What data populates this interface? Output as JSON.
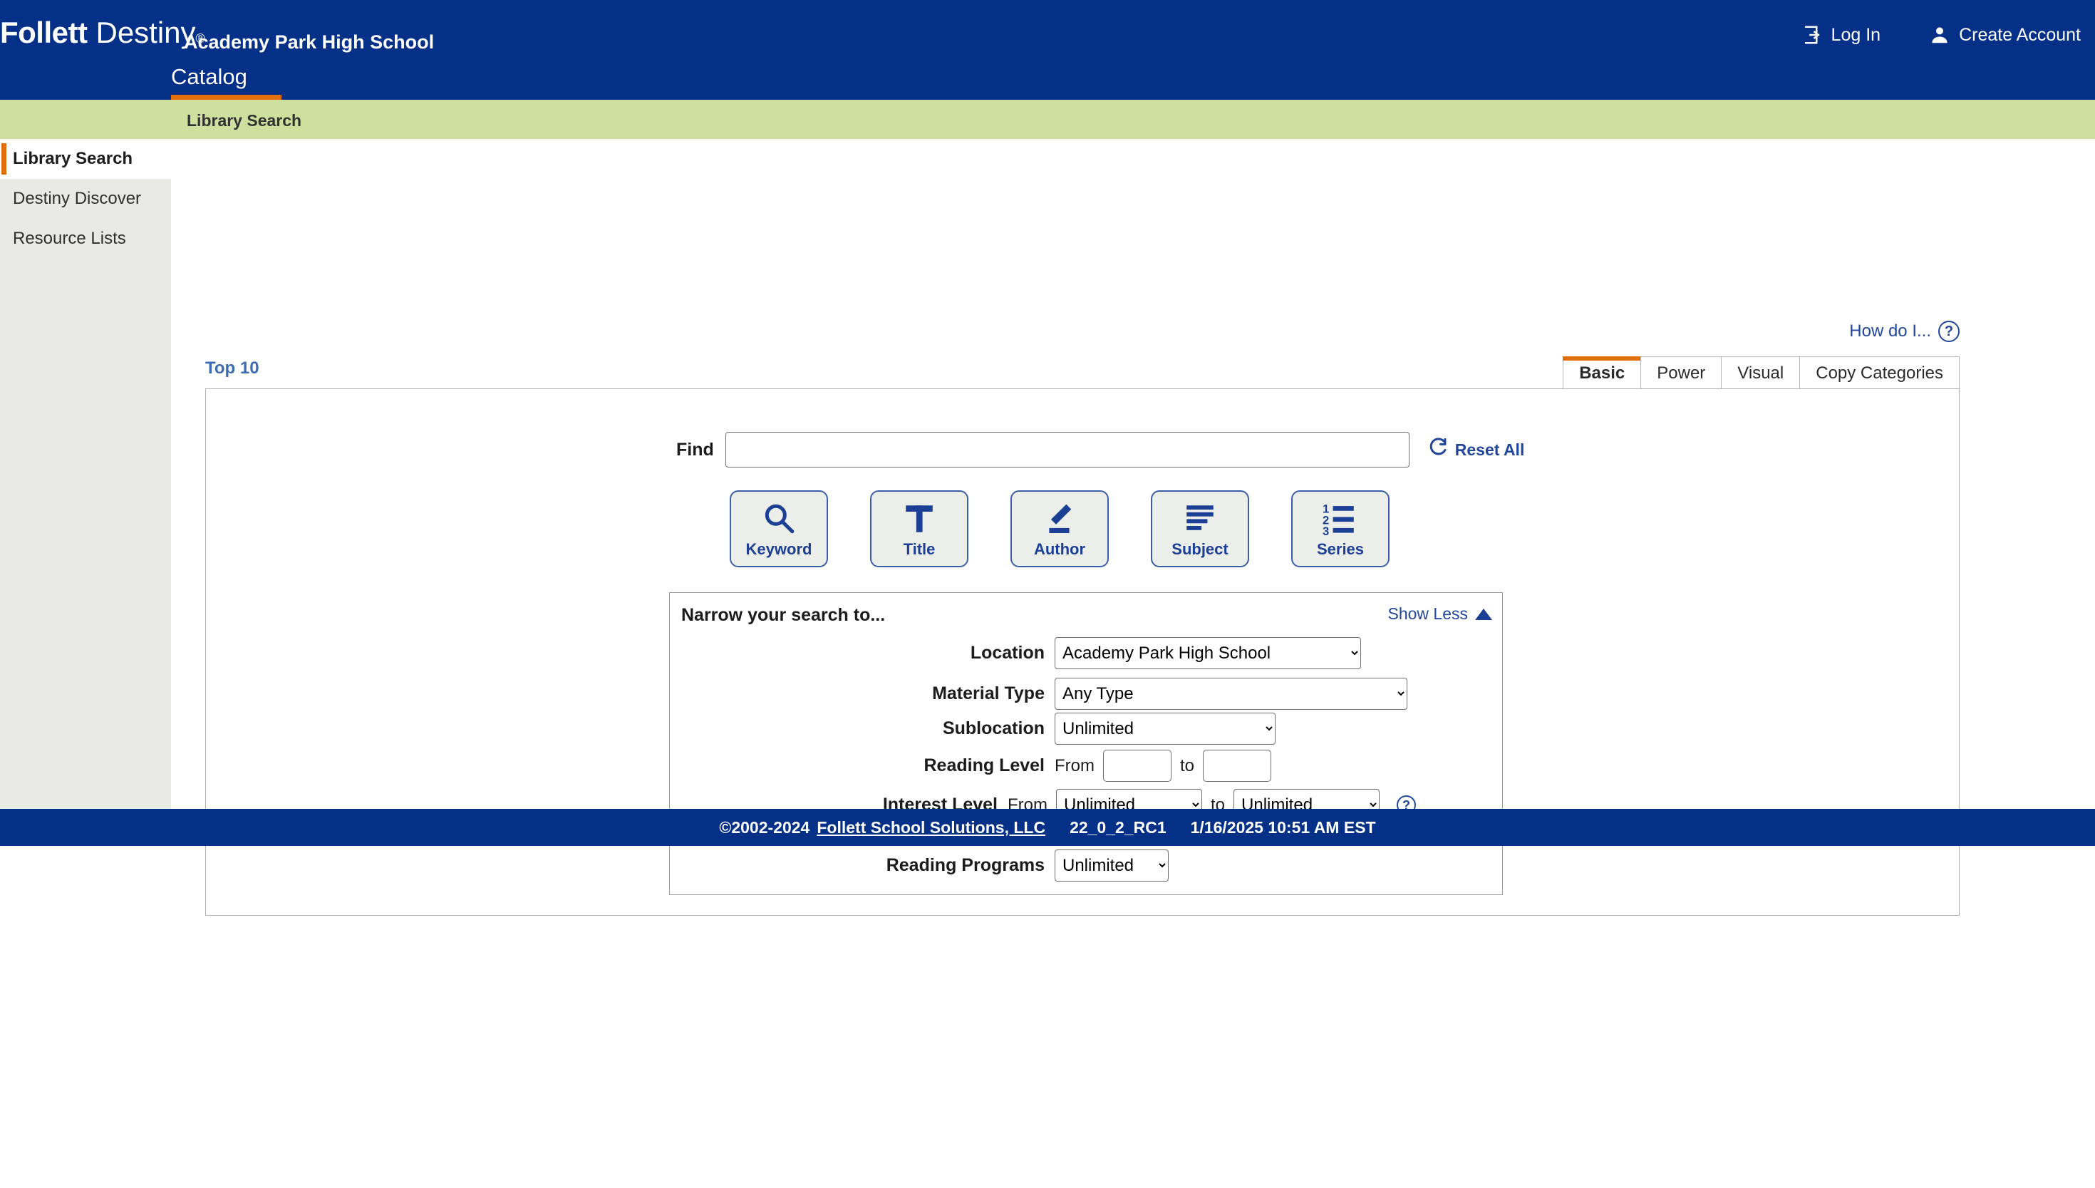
{
  "header": {
    "brand_primary": "Follett",
    "brand_secondary": "Destiny",
    "brand_registered": "®",
    "school_name": "Academy Park High School",
    "nav_tab": "Catalog",
    "login_label": "Log In",
    "create_account_label": "Create Account",
    "login_icon": "login-arrow-icon",
    "create_account_icon": "person-icon",
    "bg_color": "#043088",
    "accent_color": "#e1700a"
  },
  "breadcrumb": {
    "text": "Library Search",
    "bg_color": "#cfe09e"
  },
  "sidebar": {
    "items": [
      {
        "label": "Library Search",
        "active": true
      },
      {
        "label": "Destiny Discover",
        "active": false
      },
      {
        "label": "Resource Lists",
        "active": false
      }
    ]
  },
  "main": {
    "how_do_i_label": "How do I...",
    "how_do_i_icon": "question-circle-icon",
    "top10_label": "Top 10",
    "tabs": [
      {
        "label": "Basic",
        "active": true
      },
      {
        "label": "Power",
        "active": false
      },
      {
        "label": "Visual",
        "active": false
      },
      {
        "label": "Copy Categories",
        "active": false
      }
    ],
    "find": {
      "label": "Find",
      "value": "",
      "placeholder": "",
      "reset_label": "Reset All",
      "reset_icon": "refresh-icon"
    },
    "search_types": [
      {
        "label": "Keyword",
        "icon": "magnifier-icon"
      },
      {
        "label": "Title",
        "icon": "letter-t-icon"
      },
      {
        "label": "Author",
        "icon": "pencil-icon"
      },
      {
        "label": "Subject",
        "icon": "lines-icon"
      },
      {
        "label": "Series",
        "icon": "numbered-list-icon"
      }
    ],
    "narrow": {
      "title": "Narrow your search to...",
      "show_less_label": "Show Less",
      "show_less_icon": "triangle-up-icon",
      "location": {
        "label": "Location",
        "value": "Academy Park High School",
        "options": [
          "Academy Park High School"
        ]
      },
      "material_type": {
        "label": "Material Type",
        "value": "Any Type",
        "options": [
          "Any Type"
        ]
      },
      "sublocation": {
        "label": "Sublocation",
        "value": "Unlimited",
        "options": [
          "Unlimited"
        ]
      },
      "reading_level": {
        "label": "Reading Level",
        "from_word": "From",
        "to_word": "to",
        "from_value": "",
        "to_value": ""
      },
      "interest_level": {
        "label": "Interest Level",
        "from_word": "From",
        "to_word": "to",
        "from_value": "Unlimited",
        "to_value": "Unlimited",
        "options": [
          "Unlimited"
        ],
        "help_icon": "question-circle-icon"
      },
      "reading_programs": {
        "label": "Reading Programs",
        "value": "Unlimited",
        "options": [
          "Unlimited"
        ],
        "help_icon": "question-circle-icon"
      }
    }
  },
  "footer": {
    "copyright": "©2002-2024",
    "company_link": "Follett School Solutions, LLC",
    "version": "22_0_2_RC1",
    "timestamp": "1/16/2025 10:51 AM EST",
    "bg_color": "#043088"
  }
}
